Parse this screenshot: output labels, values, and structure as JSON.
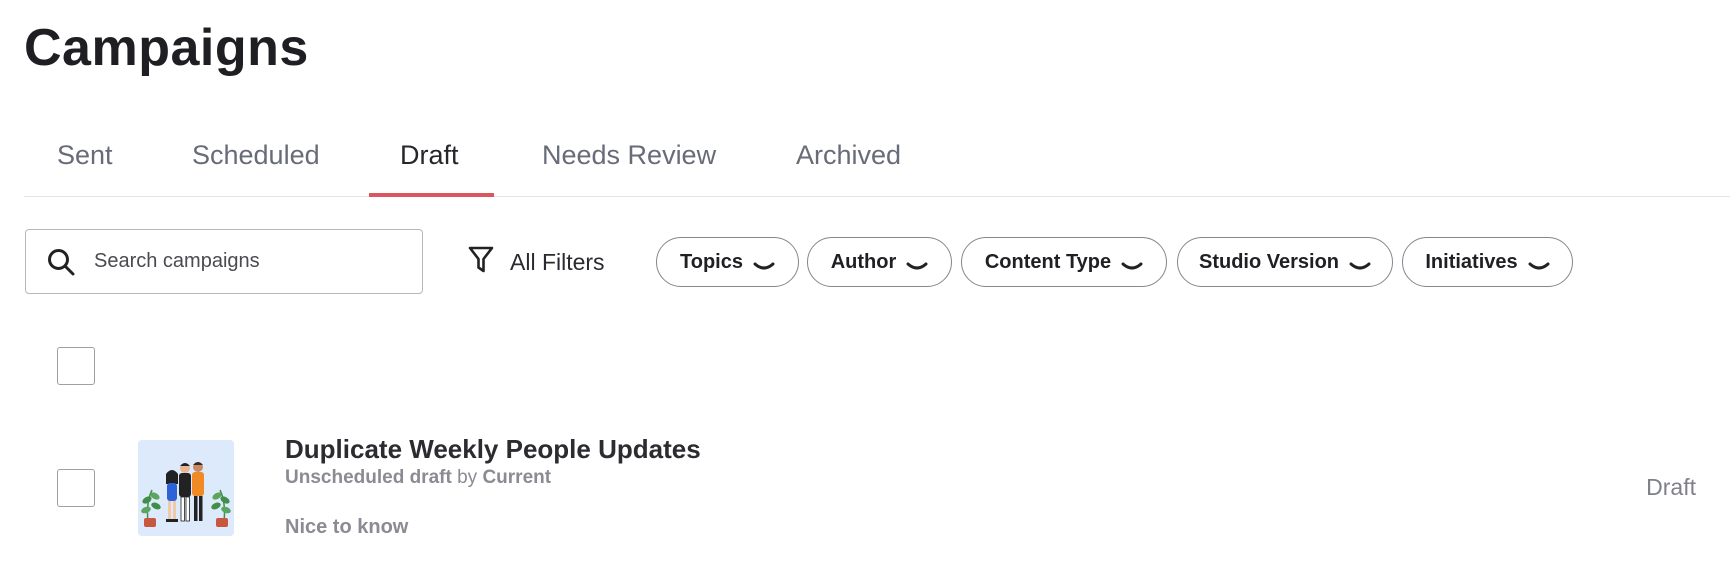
{
  "page": {
    "title": "Campaigns"
  },
  "tabs": [
    {
      "label": "Sent"
    },
    {
      "label": "Scheduled"
    },
    {
      "label": "Draft",
      "active": true
    },
    {
      "label": "Needs Review"
    },
    {
      "label": "Archived"
    }
  ],
  "accent_color": "#dc5661",
  "search": {
    "placeholder": "Search campaigns",
    "value": "",
    "icon": "search-icon"
  },
  "filters": {
    "all_label": "All Filters",
    "all_icon": "funnel-icon",
    "chips": [
      {
        "label": "Topics"
      },
      {
        "label": "Author"
      },
      {
        "label": "Content Type"
      },
      {
        "label": "Studio Version"
      },
      {
        "label": "Initiatives"
      }
    ]
  },
  "campaigns": [
    {
      "title": "Duplicate Weekly People Updates",
      "state": "Unscheduled draft",
      "by_label": "by",
      "author": "Current",
      "tag": "Nice to know",
      "status": "Draft",
      "thumbnail_icon": "people-illustration"
    }
  ]
}
